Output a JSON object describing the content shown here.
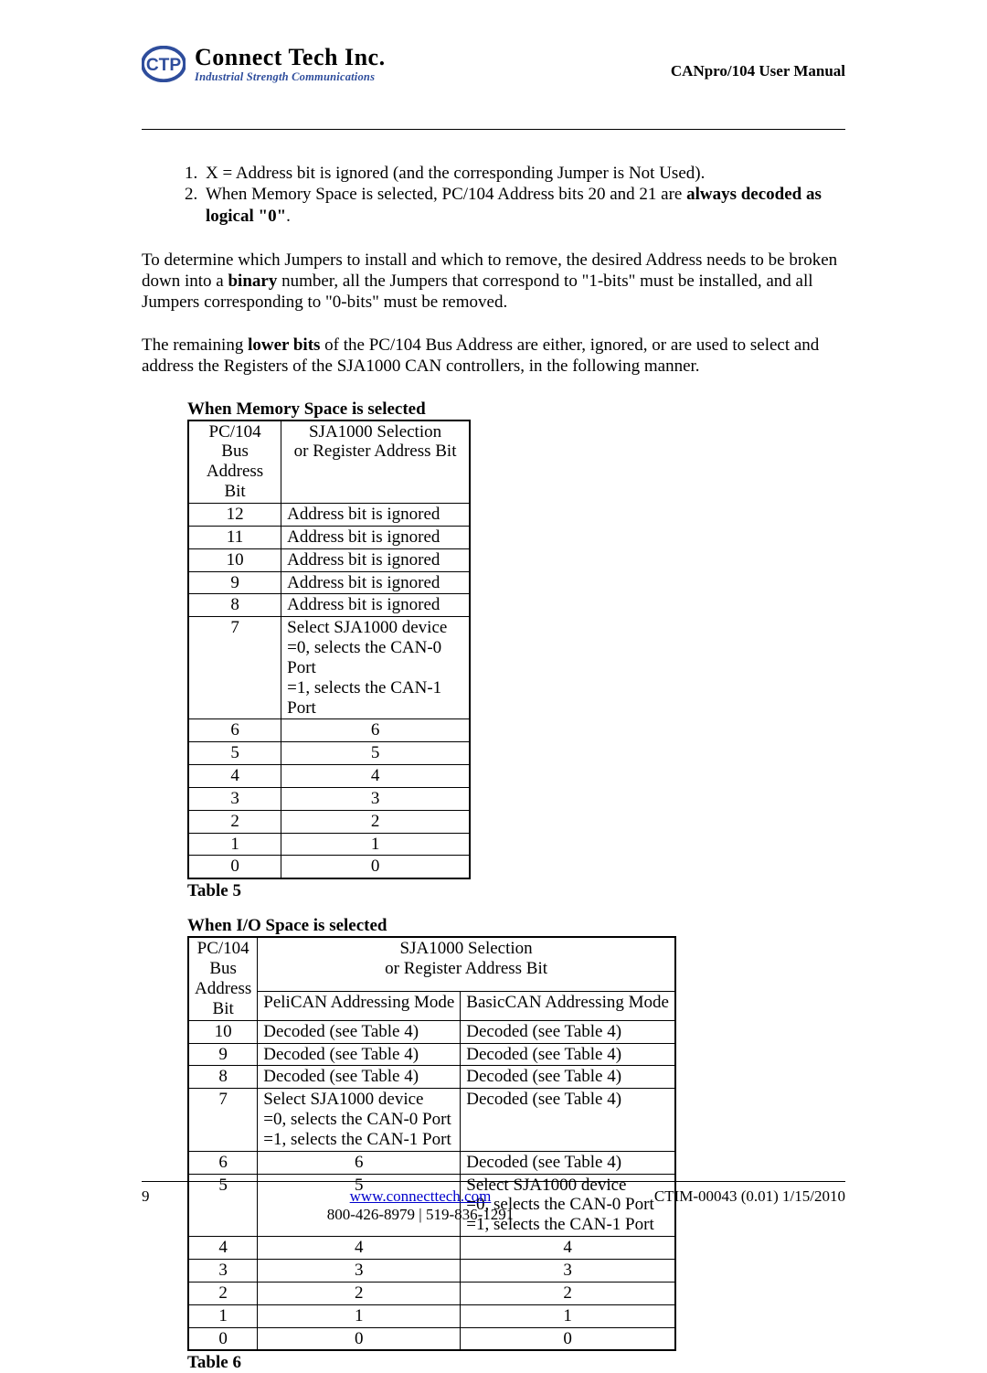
{
  "header": {
    "company_name": "Connect Tech Inc.",
    "company_tag": "Industrial Strength Communications",
    "doc_title": "CANpro/104 User Manual"
  },
  "notes": {
    "item1": "X = Address bit is ignored (and the corresponding Jumper is Not Used).",
    "item2_a": "When Memory Space is selected, PC/104 Address bits 20 and 21 are ",
    "item2_b": "always decoded as logical \"0\"",
    "item2_c": "."
  },
  "para1": {
    "a": "To determine which Jumpers to install and which to remove, the desired Address needs to be broken down into a ",
    "b": "binary",
    "c": " number, all the Jumpers that correspond to \"1-bits\" must be installed, and all Jumpers corresponding to \"0-bits\" must be removed."
  },
  "para2": {
    "a": "The remaining ",
    "b": "lower bits",
    "c": " of the PC/104 Bus Address are either, ignored, or are used to select and address the Registers of the SJA1000 CAN controllers, in the following manner."
  },
  "table5": {
    "title": "When Memory Space is selected",
    "caption": "Table 5",
    "col1_l1": "PC/104 Bus",
    "col1_l2": "Address Bit",
    "col2_l1": "SJA1000 Selection",
    "col2_l2": "or Register Address Bit",
    "rows": [
      {
        "bit": "12",
        "desc": "Address bit is ignored"
      },
      {
        "bit": "11",
        "desc": "Address bit is ignored"
      },
      {
        "bit": "10",
        "desc": "Address bit is ignored"
      },
      {
        "bit": "9",
        "desc": "Address bit is ignored"
      },
      {
        "bit": "8",
        "desc": "Address bit is ignored"
      }
    ],
    "row7": {
      "bit": "7",
      "l1": "Select SJA1000 device",
      "l2": "=0, selects the CAN-0 Port",
      "l3": "=1, selects the CAN-1 Port"
    },
    "passthru": [
      {
        "bit": "6",
        "desc": "6"
      },
      {
        "bit": "5",
        "desc": "5"
      },
      {
        "bit": "4",
        "desc": "4"
      },
      {
        "bit": "3",
        "desc": "3"
      },
      {
        "bit": "2",
        "desc": "2"
      },
      {
        "bit": "1",
        "desc": "1"
      },
      {
        "bit": "0",
        "desc": "0"
      }
    ]
  },
  "table6": {
    "title": "When I/O Space is selected",
    "caption": "Table 6",
    "col1_l1": "PC/104 Bus",
    "col1_l2": "Address Bit",
    "col2_l1": "SJA1000 Selection",
    "col2_l2": "or Register Address Bit",
    "sub1": "PeliCAN Addressing Mode",
    "sub2": "BasicCAN Addressing Mode",
    "decoded": "Decoded (see Table 4)",
    "sel": {
      "l1": "Select SJA1000 device",
      "l2": "=0, selects the CAN-0 Port",
      "l3": "=1, selects the CAN-1 Port"
    },
    "bits": {
      "b10": "10",
      "b9": "9",
      "b8": "8",
      "b7": "7",
      "b6": "6",
      "b5": "5",
      "b4": "4",
      "b3": "3",
      "b2": "2",
      "b1": "1",
      "b0": "0"
    }
  },
  "footer": {
    "page": "9",
    "url": "www.connecttech.com",
    "docnum": "CTIM-00043 (0.01) 1/15/2010",
    "phones": "800-426-8979 | 519-836-1291"
  }
}
